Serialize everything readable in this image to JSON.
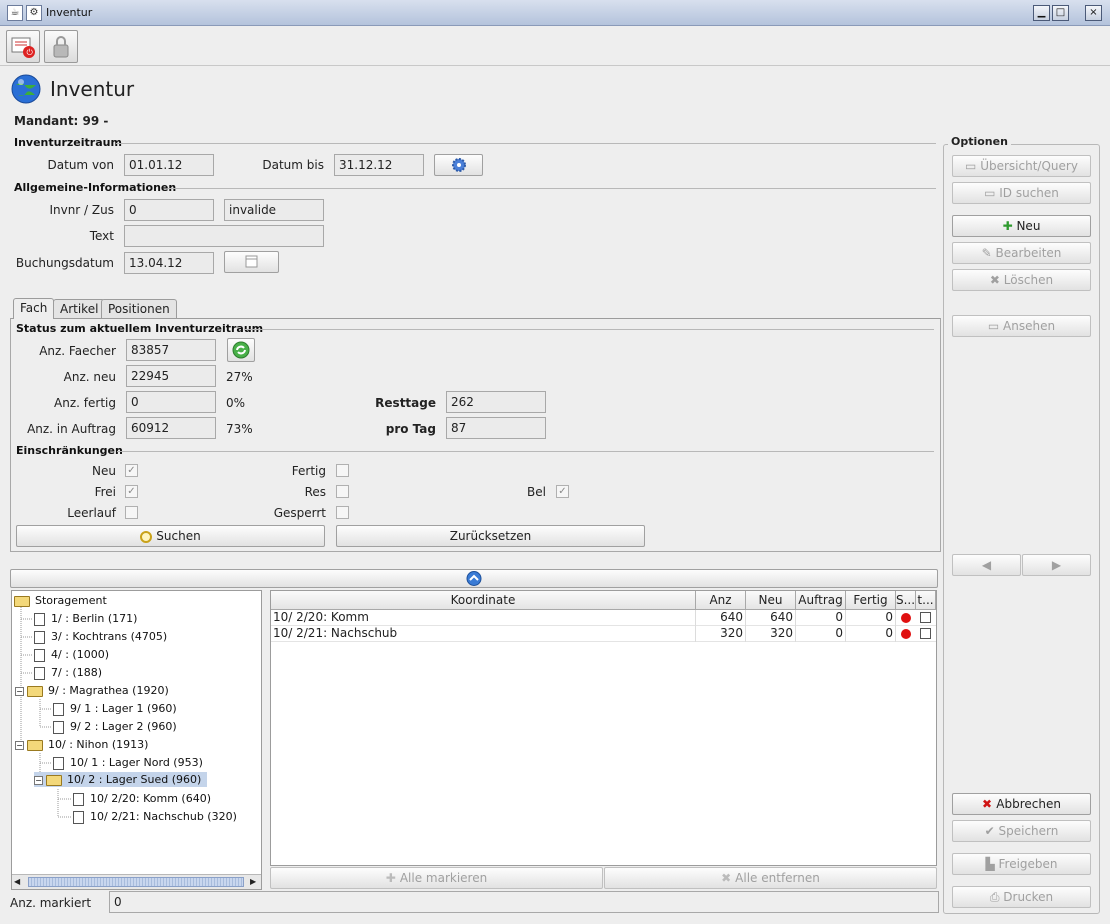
{
  "window": {
    "title": "Inventur",
    "min": "▁",
    "max": "□",
    "close": "×"
  },
  "header": {
    "title": "Inventur",
    "mandant": "Mandant: 99 -"
  },
  "zeitraum": {
    "section": "Inventurzeitraum",
    "von_label": "Datum von",
    "von": "01.01.12",
    "bis_label": "Datum bis",
    "bis": "31.12.12"
  },
  "allg": {
    "section": "Allgemeine-Informationen",
    "invnr_label": "Invnr / Zus",
    "invnr": "0",
    "zus": "invalide",
    "text_label": "Text",
    "text": "",
    "buchung_label": "Buchungsdatum",
    "buchung": "13.04.12"
  },
  "tabs": [
    "Fach",
    "Artikel",
    "Positionen"
  ],
  "status": {
    "section": "Status zum aktuellem Inventurzeitraum",
    "faecher_label": "Anz. Faecher",
    "faecher": "83857",
    "neu_label": "Anz. neu",
    "neu": "22945",
    "neu_pct": "27%",
    "fertig_label": "Anz. fertig",
    "fertig": "0",
    "fertig_pct": "0%",
    "auftrag_label": "Anz. in Auftrag",
    "auftrag": "60912",
    "auftrag_pct": "73%",
    "resttage_label": "Resttage",
    "resttage": "262",
    "protag_label": "pro Tag",
    "protag": "87"
  },
  "einschr": {
    "section": "Einschränkungen",
    "neu": "Neu",
    "frei": "Frei",
    "leerlauf": "Leerlauf",
    "fertig": "Fertig",
    "res": "Res",
    "gesperrt": "Gesperrt",
    "bel": "Bel",
    "check": "✓"
  },
  "buttons": {
    "suchen": "Suchen",
    "reset": "Zurücksetzen",
    "alle_markieren": "Alle markieren",
    "alle_entfernen": "Alle entfernen"
  },
  "tree": {
    "root": "Storagement",
    "n1": "1/    : Berlin    (171)",
    "n3": "3/    : Kochtrans    (4705)",
    "n4": "4/    :                     (1000)",
    "n7": "7/    :                     (188)",
    "n9": "9/    : Magrathea    (1920)",
    "n91": "9/ 1   : Lager 1    (960)",
    "n92": "9/ 2   : Lager 2    (960)",
    "n10": "10/     : Nihon    (1913)",
    "n101": "10/ 1   : Lager Nord    (953)",
    "n102": "10/ 2   : Lager Sued    (960)",
    "n1020": "10/ 2/20: Komm    (640)",
    "n1021": "10/ 2/21: Nachschub    (320)"
  },
  "table": {
    "headers": [
      "Koordinate",
      "Anz",
      "Neu",
      "Auftrag",
      "Fertig",
      "S...",
      "t..."
    ],
    "rows": [
      {
        "koord": "10/ 2/20: Komm",
        "anz": "640",
        "neu": "640",
        "auftrag": "0",
        "fertig": "0"
      },
      {
        "koord": "10/ 2/21: Nachschub",
        "anz": "320",
        "neu": "320",
        "auftrag": "0",
        "fertig": "0"
      }
    ]
  },
  "footer": {
    "markiert_label": "Anz. markiert",
    "markiert": "0"
  },
  "optionen": {
    "title": "Optionen",
    "uebersicht": "Übersicht/Query",
    "id_suchen": "ID suchen",
    "neu": "Neu",
    "bearbeiten": "Bearbeiten",
    "loeschen": "Löschen",
    "ansehen": "Ansehen",
    "abbrechen": "Abbrechen",
    "speichern": "Speichern",
    "freigeben": "Freigeben",
    "drucken": "Drucken"
  }
}
